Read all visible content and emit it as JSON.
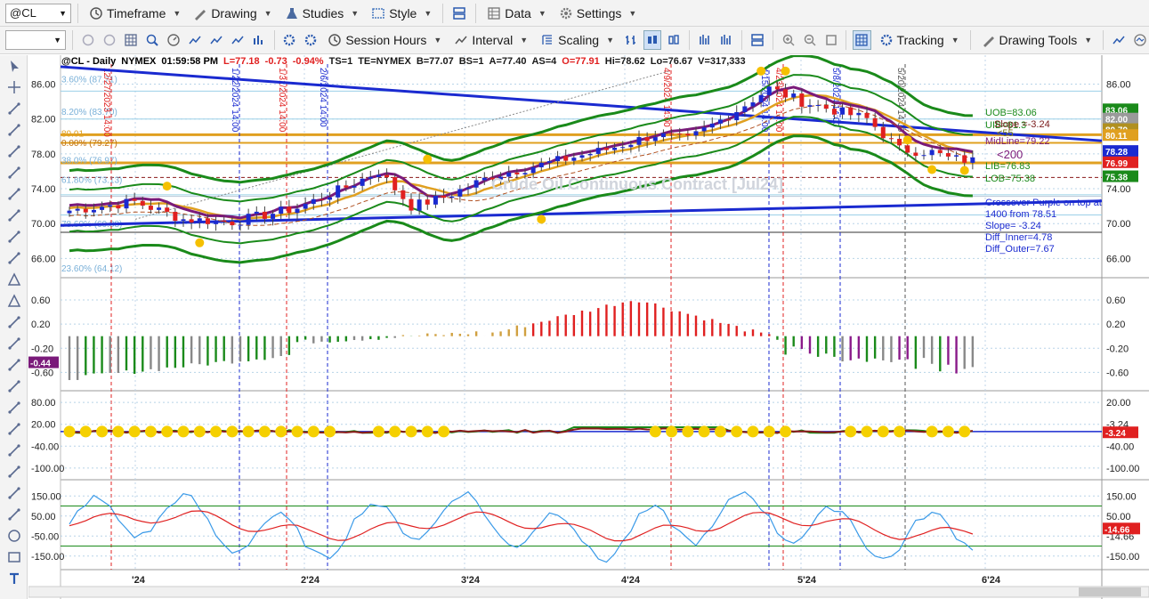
{
  "toolbar1": {
    "symbol": "@CL",
    "timeframe": "Timeframe",
    "drawing": "Drawing",
    "studies": "Studies",
    "style": "Style",
    "data": "Data",
    "settings": "Settings"
  },
  "toolbar2": {
    "session_hours": "Session Hours",
    "interval": "Interval",
    "scaling": "Scaling",
    "tracking": "Tracking",
    "drawing_tools": "Drawing Tools"
  },
  "header": {
    "symbol": "@CL - Daily",
    "exchange": "NYMEX",
    "time": "01:59:58 PM",
    "last": "L=77.18",
    "chg": "-0.73",
    "pct": "-0.94%",
    "ts": "TS=1",
    "te": "TE=NYMEX",
    "bid": "B=77.07",
    "bs": "BS=1",
    "ask": "A=77.40",
    "as": "AS=4",
    "open": "O=77.91",
    "hi": "Hi=78.62",
    "lo": "Lo=76.67",
    "vol": "V=317,333"
  },
  "price_panel": {
    "axis": [
      "86.00",
      "82.00",
      "78.00",
      "74.00",
      "70.00",
      "66.00"
    ],
    "fib_labels": [
      "3.60% (87.71)",
      "8.20% (83.70)",
      "0.00% (79.27)",
      "38.0% (76.97)",
      "61.80% (73.13)",
      "78.60% (69.88)",
      "23.60% (64.12)"
    ],
    "fib_80": "80.01",
    "uob": "UOB=83.06",
    "uib": "UIB=81.3",
    "slope_top": "Slope =-3.24",
    "lt55": "<55",
    "midline": "MidLine=79.22",
    "lt200": "<200",
    "lib": "LIB=76.83",
    "lob": "LOB=75.38",
    "crossover_1": "Crossover Purple on top at",
    "crossover_2": "1400 from 78.51",
    "crossover_3": "Slope= -3.24",
    "crossover_4": "Diff_Inner=4.78",
    "crossover_5": "Diff_Outer=7.67",
    "watermark": "Crude Oil Continuous Contract [Jul24]",
    "tags": [
      {
        "v": "83.06",
        "c": "#1a8a1a"
      },
      {
        "v": "82.00",
        "c": "#9a9a9a"
      },
      {
        "v": "80.79",
        "c": "#b09020"
      },
      {
        "v": "80.11",
        "c": "#e0a020"
      },
      {
        "v": "78.28",
        "c": "#1a2ad0"
      },
      {
        "v": "76.99",
        "c": "#e02020"
      },
      {
        "v": "75.38",
        "c": "#1a8a1a"
      }
    ],
    "vlines": [
      "12/27/2023 14:00",
      "1/22/2024 14:00",
      "1/31/2024 14:00",
      "2/6/2024 14:00",
      "4/9/2024 14:00",
      "4/15/2024 14:00",
      "4/23/2024 14:00",
      "5/8/2024 14:00",
      "5/20/2024 14:00"
    ]
  },
  "macd_panel": {
    "axis": [
      "0.60",
      "0.20",
      "-0.20",
      "-0.60"
    ],
    "last": "-0.44"
  },
  "osc_panel": {
    "axis": [
      "80.00",
      "20.00",
      "-40.00",
      "-100.00"
    ],
    "axis_right": [
      "20.00",
      "-3.24",
      "-40.00",
      "-100.00"
    ],
    "last": "-3.24"
  },
  "cci_panel": {
    "axis": [
      "150.00",
      "50.00",
      "-50.00",
      "-150.00"
    ],
    "axis_right": [
      "150.00",
      "50.00",
      "-14.66",
      "-150.00"
    ],
    "last": "-14.66"
  },
  "time_axis": [
    "'24",
    "2'24",
    "3'24",
    "4'24",
    "5'24",
    "6'24"
  ],
  "colors": {
    "up": "#1a2ad0",
    "down": "#e02020",
    "band_green": "#1a8a1a",
    "gold": "#e0a020",
    "purple": "#7a1a7a",
    "trend": "#1a2ad0"
  }
}
